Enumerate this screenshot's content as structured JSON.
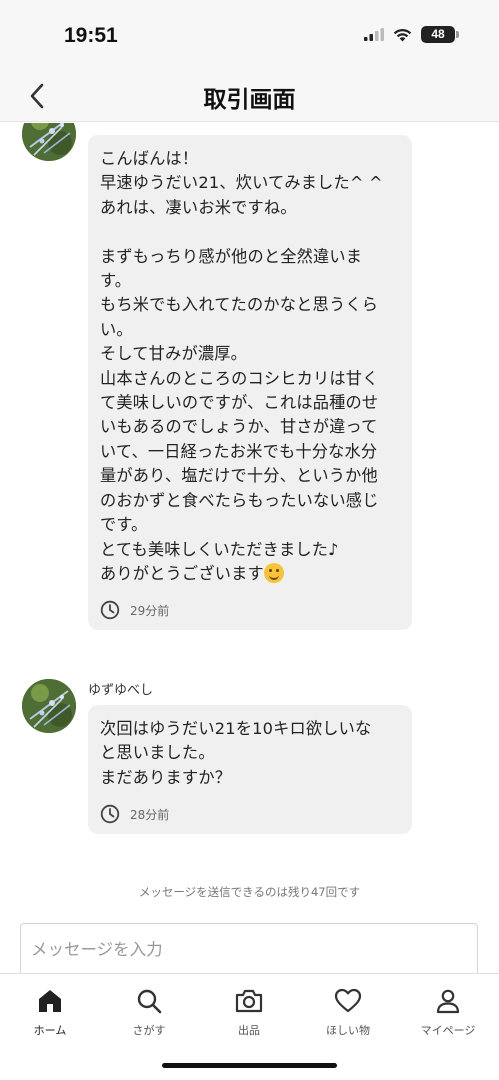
{
  "status_bar": {
    "time": "19:51",
    "battery": "48",
    "icons": [
      "signal-icon",
      "wifi-icon",
      "battery-icon"
    ]
  },
  "header": {
    "title": "取引画面",
    "back_icon": "chevron-left-icon"
  },
  "messages": [
    {
      "sender": "",
      "text": "こんばんは！\n早速ゆうだい21、炊いてみました^ ^\nあれは、凄いお米ですね。\n\nまずもっちり感が他のと全然違いま\nす。\nもち米でも入れてたのかなと思うくら\nい。\nそして甘みが濃厚。\n山本さんのところのコシヒカリは甘く\nて美味しいのですが、これは品種のせ\nいもあるのでしょうか、甘さが違って\nいて、一日経ったお米でも十分な水分\n量があり、塩だけで十分、というか他\nのおかずと食べたらもったいない感じ\nです。\nとても美味しくいただきました♪\nありがとうございます",
      "emoji": "smiling-face-emoji",
      "time": "29分前"
    },
    {
      "sender": "ゆずゆべし",
      "text": "次回はゆうだい21を10キロ欲しいな\nと思いました。\nまだありますか？",
      "time": "28分前"
    }
  ],
  "notice": "メッセージを送信できるのは残り47回です",
  "input": {
    "placeholder": "メッセージを入力"
  },
  "tab_bar": {
    "items": [
      {
        "label": "ホーム",
        "icon": "home-icon",
        "active": true
      },
      {
        "label": "さがす",
        "icon": "search-icon",
        "active": false
      },
      {
        "label": "出品",
        "icon": "camera-icon",
        "active": false
      },
      {
        "label": "ほしい物",
        "icon": "heart-icon",
        "active": false
      },
      {
        "label": "マイページ",
        "icon": "person-icon",
        "active": false
      }
    ]
  },
  "colors": {
    "bubble": "#f0f0f0",
    "bar_background": "#f7f7f7",
    "text": "#222222"
  }
}
